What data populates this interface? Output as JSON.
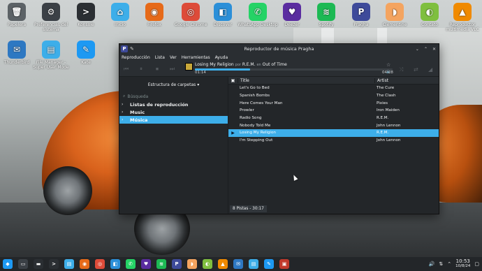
{
  "desktop": {
    "icons_row1": [
      {
        "label": "Papelera",
        "name": "papelera",
        "color": "#5c6266",
        "glyph": "🗑"
      },
      {
        "label": "Preferencias del sistema",
        "name": "preferencias",
        "color": "#3b4046",
        "glyph": "⚙"
      },
      {
        "label": "Konsole",
        "name": "konsole",
        "color": "#2b2f33",
        "glyph": ">"
      },
      {
        "label": "Inicio",
        "name": "inicio",
        "color": "#3daee9",
        "glyph": "⌂"
      },
      {
        "label": "Firefox",
        "name": "firefox",
        "color": "#e66a19",
        "glyph": "◉"
      },
      {
        "label": "Google Chrome",
        "name": "chrome",
        "color": "#dd4b39",
        "glyph": "◎"
      },
      {
        "label": "Discover",
        "name": "discover",
        "color": "#2b8fd8",
        "glyph": "◧"
      },
      {
        "label": "WhatsApp Desktop",
        "name": "whatsapp",
        "color": "#25d366",
        "glyph": "✆"
      },
      {
        "label": "Deezer",
        "name": "deezer",
        "color": "#5a2ca0",
        "glyph": "♥"
      },
      {
        "label": "Spotify",
        "name": "spotify",
        "color": "#1db954",
        "glyph": "≋"
      },
      {
        "label": "Pragha",
        "name": "pragha",
        "color": "#3e4a9a",
        "glyph": "P"
      },
      {
        "label": "Clementine",
        "name": "clementine",
        "color": "#f4a460",
        "glyph": "◗"
      },
      {
        "label": "Contato",
        "name": "contato",
        "color": "#7fbf3f",
        "glyph": "◐"
      },
      {
        "label": "Reproductor multimedia VLC",
        "name": "vlc",
        "color": "#f08a00",
        "glyph": "▲"
      }
    ],
    "icons_row2": [
      {
        "label": "Thunderbird",
        "name": "thunderbird",
        "color": "#2e78c2",
        "glyph": "✉"
      },
      {
        "label": "File Manager - Super User Mode",
        "name": "file-manager-su",
        "color": "#3daee9",
        "glyph": "▤"
      },
      {
        "label": "Kate",
        "name": "kate",
        "color": "#1d99f3",
        "glyph": "✎"
      }
    ]
  },
  "window": {
    "title": "Reproductor de música Pragha",
    "app_icon": "P",
    "controls": [
      "⌄",
      "⌃",
      "✕"
    ]
  },
  "menu": [
    "Reproducción",
    "Lista",
    "Ver",
    "Herramientas",
    "Ayuda"
  ],
  "now_playing": {
    "track": "Losing My Religion",
    "by_word": "por",
    "artist": "R.E.M.",
    "in_word": "en",
    "album": "Out of Time",
    "elapsed": "01:14",
    "total": "04:28",
    "progress_fraction": 0.28
  },
  "sidebar": {
    "folder_selector": "Estructura de carpetas",
    "search_placeholder": "Búsqueda",
    "tree": [
      {
        "label": "Listas de reproducción",
        "chevron": "›",
        "selected": false
      },
      {
        "label": "Music",
        "chevron": "›",
        "selected": false
      },
      {
        "label": "Música",
        "chevron": "›",
        "selected": true
      }
    ]
  },
  "playlist": {
    "columns": {
      "title": "Title",
      "artist": "Artist"
    },
    "rows": [
      {
        "title": "Let's Go to Bed",
        "artist": "The Cure",
        "playing": false
      },
      {
        "title": "Spanish Bombs",
        "artist": "The Clash",
        "playing": false
      },
      {
        "title": "Here Comes Your Man",
        "artist": "Pixies",
        "playing": false
      },
      {
        "title": "Prowler",
        "artist": "Iron Maiden",
        "playing": false
      },
      {
        "title": "Radio Song",
        "artist": "R.E.M.",
        "playing": false
      },
      {
        "title": "Nobody Told Me",
        "artist": "John Lennon",
        "playing": false
      },
      {
        "title": "Losing My Religion",
        "artist": "R.E.M.",
        "playing": true
      },
      {
        "title": "I'm Stepping Out",
        "artist": "John Lennon",
        "playing": false
      }
    ],
    "status": "8 Pistas - 30:17"
  },
  "taskbar": {
    "items": [
      {
        "name": "kde-menu",
        "color": "#1d99f3",
        "glyph": "◆"
      },
      {
        "name": "desktop-pager",
        "color": "#3b4046",
        "glyph": "▭"
      },
      {
        "name": "task-manager",
        "color": "#2b2f33",
        "glyph": "▬"
      },
      {
        "name": "konsole",
        "color": "#2b2f33",
        "glyph": ">"
      },
      {
        "name": "dolphin",
        "color": "#3daee9",
        "glyph": "▤"
      },
      {
        "name": "firefox",
        "color": "#e66a19",
        "glyph": "◉"
      },
      {
        "name": "chrome",
        "color": "#dd4b39",
        "glyph": "◎"
      },
      {
        "name": "discover",
        "color": "#2b8fd8",
        "glyph": "◧"
      },
      {
        "name": "whatsapp",
        "color": "#25d366",
        "glyph": "✆"
      },
      {
        "name": "deezer",
        "color": "#5a2ca0",
        "glyph": "♥"
      },
      {
        "name": "spotify",
        "color": "#1db954",
        "glyph": "≋"
      },
      {
        "name": "pragha",
        "color": "#3e4a9a",
        "glyph": "P"
      },
      {
        "name": "clementine",
        "color": "#f4a460",
        "glyph": "◗"
      },
      {
        "name": "contato",
        "color": "#7fbf3f",
        "glyph": "◐"
      },
      {
        "name": "vlc",
        "color": "#f08a00",
        "glyph": "▲"
      },
      {
        "name": "thunderbird",
        "color": "#2e78c2",
        "glyph": "✉"
      },
      {
        "name": "file-manager",
        "color": "#3daee9",
        "glyph": "▤"
      },
      {
        "name": "kate",
        "color": "#1d99f3",
        "glyph": "✎"
      },
      {
        "name": "app-launcher",
        "color": "#c0392b",
        "glyph": "▣"
      }
    ],
    "clock_time": "10:53",
    "clock_date": "10/8/24"
  },
  "colors": {
    "accent": "#3daee9",
    "window_bg": "#232629",
    "panel_bg": "#2a2e32"
  }
}
